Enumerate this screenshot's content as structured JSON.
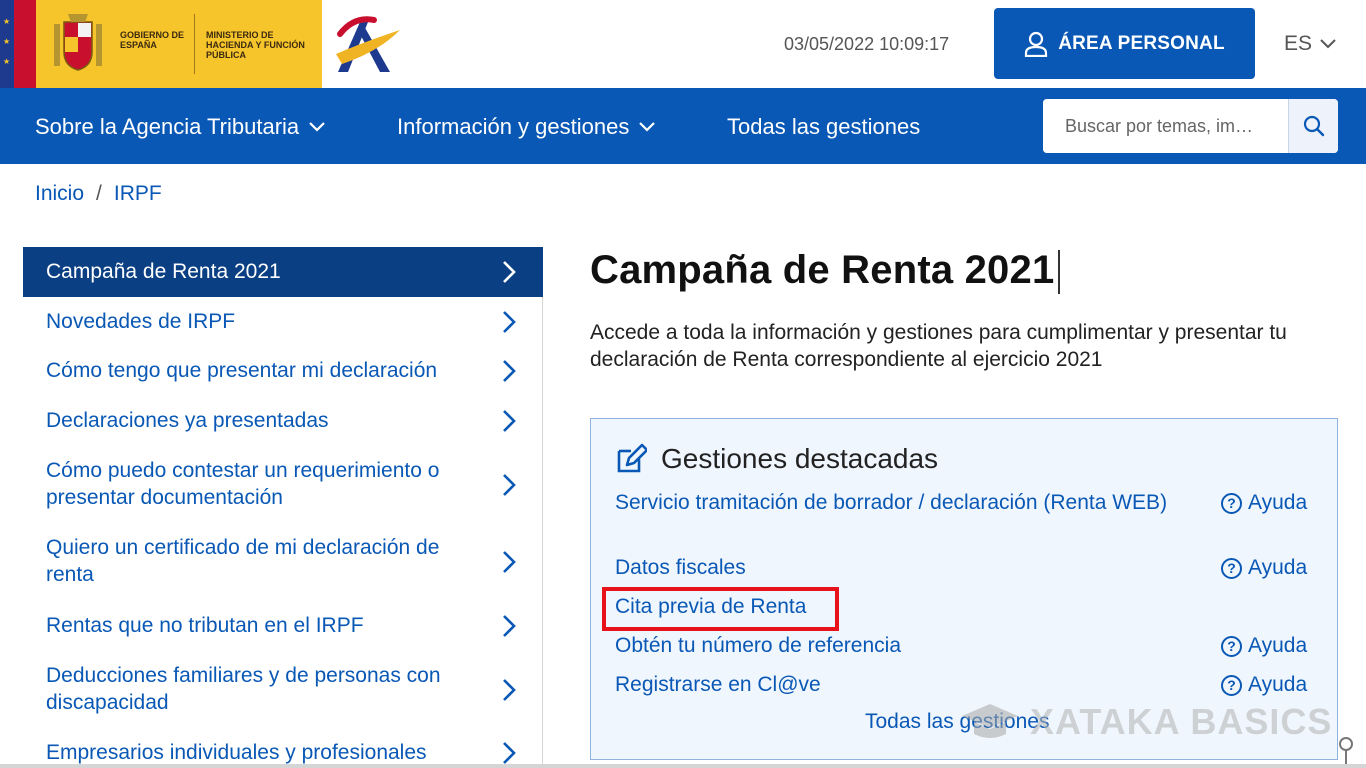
{
  "header": {
    "gov_name": "GOBIERNO DE ESPAÑA",
    "ministry_name": "MINISTERIO DE HACIENDA Y FUNCIÓN PÚBLICA",
    "datetime": "03/05/2022 10:09:17",
    "area_personal_label": "ÁREA PERSONAL",
    "language": "ES"
  },
  "nav": {
    "items": [
      {
        "label": "Sobre la Agencia Tributaria",
        "has_dropdown": true
      },
      {
        "label": "Información y gestiones",
        "has_dropdown": true
      },
      {
        "label": "Todas las gestiones",
        "has_dropdown": false
      }
    ],
    "search_placeholder": "Buscar por temas, im…"
  },
  "breadcrumb": {
    "items": [
      "Inicio",
      "IRPF"
    ],
    "separator": "/"
  },
  "sidebar": {
    "items": [
      {
        "label": "Campaña de Renta 2021",
        "active": true
      },
      {
        "label": "Novedades de IRPF",
        "active": false
      },
      {
        "label": "Cómo tengo que presentar mi declaración",
        "active": false
      },
      {
        "label": "Declaraciones ya presentadas",
        "active": false
      },
      {
        "label": "Cómo puedo contestar un requerimiento o presentar documentación",
        "active": false
      },
      {
        "label": "Quiero un certificado de mi declaración de renta",
        "active": false
      },
      {
        "label": "Rentas que no tributan en el IRPF",
        "active": false
      },
      {
        "label": "Deducciones familiares y de personas con discapacidad",
        "active": false
      },
      {
        "label": "Empresarios individuales y profesionales",
        "active": false
      }
    ]
  },
  "main": {
    "title": "Campaña de Renta 2021",
    "intro": "Accede a toda la información y gestiones para cumplimentar y presentar tu declaración de Renta correspondiente al ejercicio 2021"
  },
  "gestiones": {
    "title": "Gestiones destacadas",
    "help_label": "Ayuda",
    "items": [
      {
        "label": "Servicio tramitación de borrador / declaración (Renta WEB)",
        "has_help": true
      },
      {
        "label": "Datos fiscales",
        "has_help": true
      },
      {
        "label": "Cita previa de Renta",
        "has_help": false,
        "highlighted": true
      },
      {
        "label": "Obtén tu número de referencia",
        "has_help": true
      },
      {
        "label": "Registrarse en Cl@ve",
        "has_help": true
      }
    ],
    "all_link": "Todas las gestiones"
  },
  "watermark": "XATAKA BASICS",
  "colors": {
    "primary": "#0a58b5",
    "sidebar_active": "#0a3f83",
    "panel_bg": "#f0f6fd",
    "highlight": "#e8121a",
    "gov_yellow": "#f6c42b"
  }
}
